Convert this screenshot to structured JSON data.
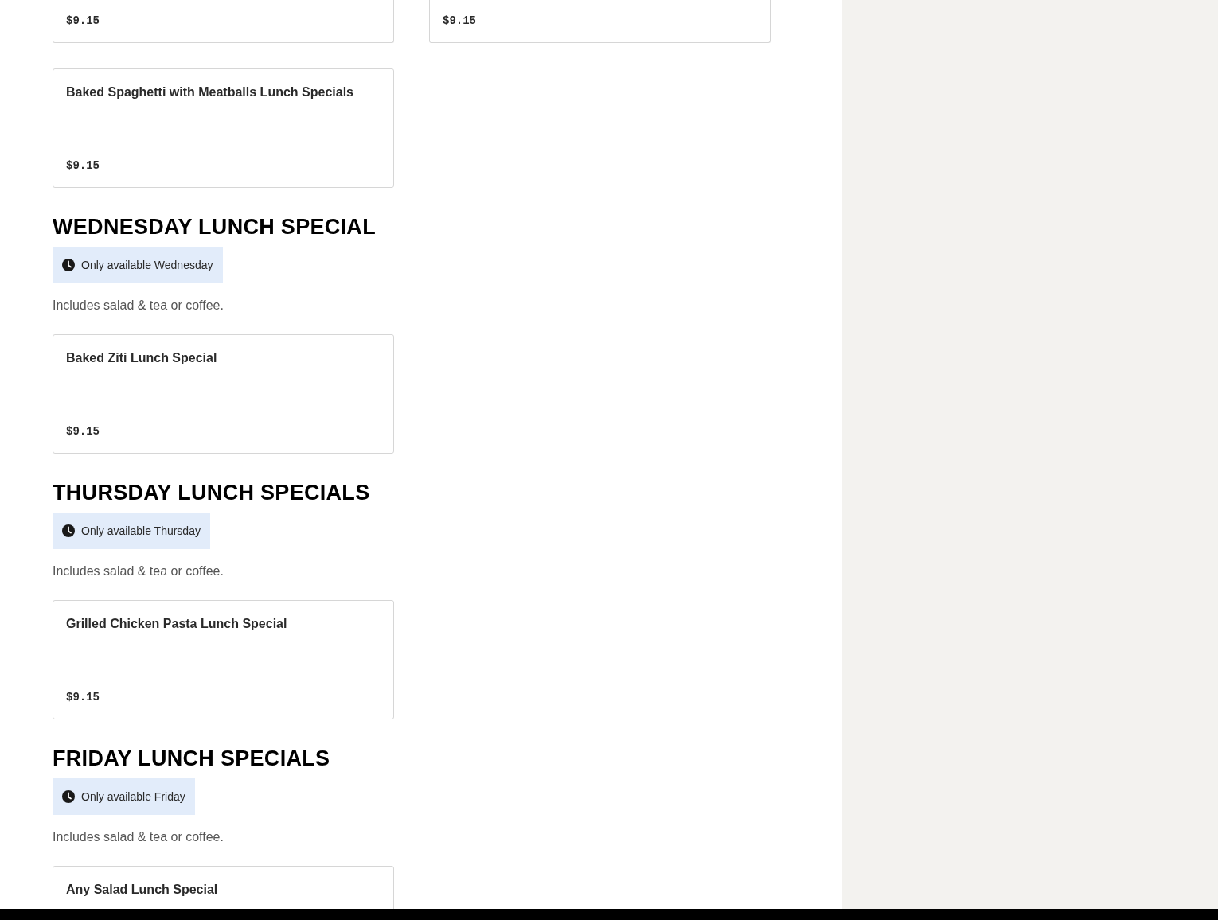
{
  "cut_off_items": [
    {
      "price": "$9.15"
    },
    {
      "price": "$9.15"
    }
  ],
  "sections": [
    {
      "items": [
        {
          "name": "Baked Spaghetti with Meatballs Lunch Specials",
          "price": "$9.15"
        }
      ]
    },
    {
      "heading": "WEDNESDAY LUNCH SPECIAL",
      "availability": "Only available Wednesday",
      "description": "Includes salad & tea or coffee.",
      "items": [
        {
          "name": "Baked Ziti Lunch Special",
          "price": "$9.15"
        }
      ]
    },
    {
      "heading": "THURSDAY LUNCH SPECIALS",
      "availability": "Only available Thursday",
      "description": "Includes salad & tea or coffee.",
      "items": [
        {
          "name": "Grilled Chicken Pasta Lunch Special",
          "price": "$9.15"
        }
      ]
    },
    {
      "heading": "FRIDAY LUNCH SPECIALS",
      "availability": "Only available Friday",
      "description": "Includes salad & tea or coffee.",
      "items": [
        {
          "name": "Any Salad Lunch Special"
        }
      ]
    }
  ]
}
